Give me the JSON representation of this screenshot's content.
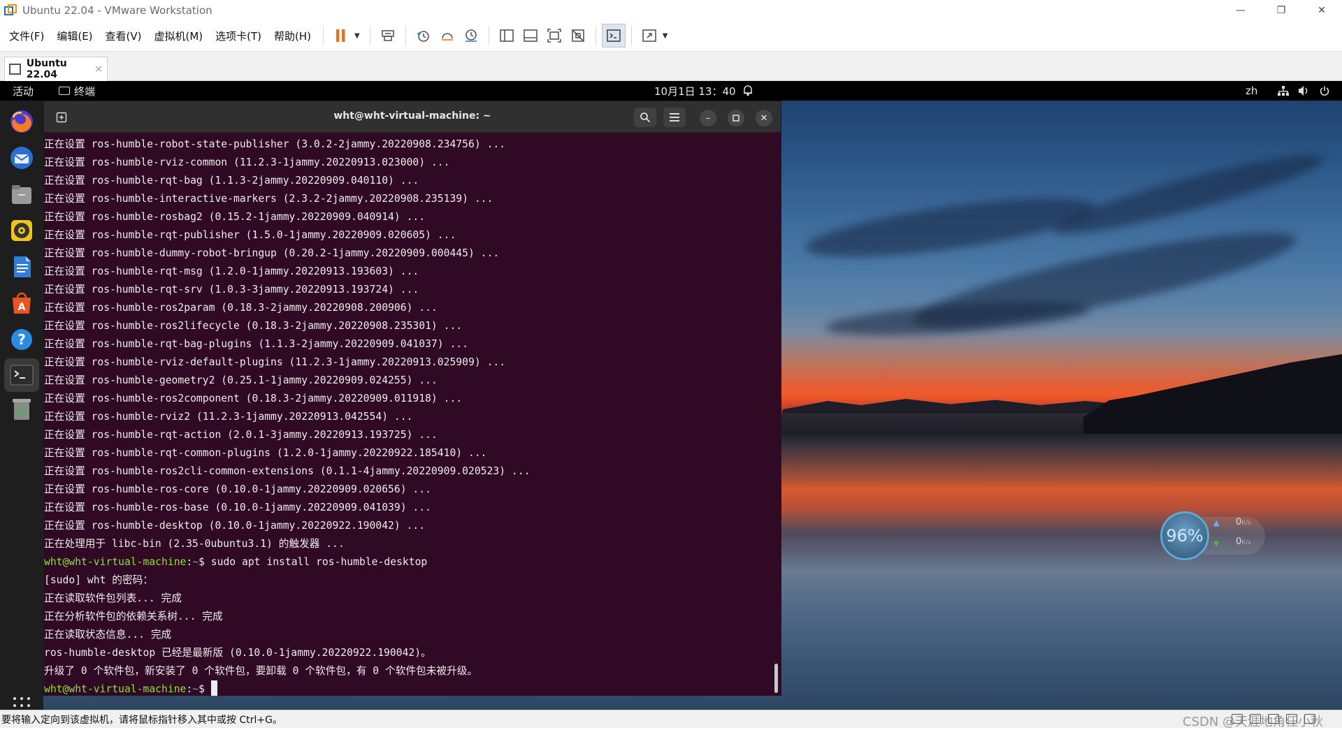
{
  "window": {
    "title": "Ubuntu 22.04 - VMware Workstation",
    "controls": {
      "minimize": "—",
      "restore": "❐",
      "close": "✕"
    }
  },
  "menu": [
    "文件(F)",
    "编辑(E)",
    "查看(V)",
    "虚拟机(M)",
    "选项卡(T)",
    "帮助(H)"
  ],
  "tab": {
    "label": "Ubuntu 22.04",
    "close": "×"
  },
  "gnome": {
    "activities": "活动",
    "app": "终端",
    "clock": "10月1日  13：40",
    "lang": "zh"
  },
  "terminal": {
    "title": "wht@wht-virtual-machine: ~",
    "lines": [
      "正在设置 ros-humble-robot-state-publisher (3.0.2-2jammy.20220908.234756) ...",
      "正在设置 ros-humble-rviz-common (11.2.3-1jammy.20220913.023000) ...",
      "正在设置 ros-humble-rqt-bag (1.1.3-2jammy.20220909.040110) ...",
      "正在设置 ros-humble-interactive-markers (2.3.2-2jammy.20220908.235139) ...",
      "正在设置 ros-humble-rosbag2 (0.15.2-1jammy.20220909.040914) ...",
      "正在设置 ros-humble-rqt-publisher (1.5.0-1jammy.20220909.020605) ...",
      "正在设置 ros-humble-dummy-robot-bringup (0.20.2-1jammy.20220909.000445) ...",
      "正在设置 ros-humble-rqt-msg (1.2.0-1jammy.20220913.193603) ...",
      "正在设置 ros-humble-rqt-srv (1.0.3-3jammy.20220913.193724) ...",
      "正在设置 ros-humble-ros2param (0.18.3-2jammy.20220908.200906) ...",
      "正在设置 ros-humble-ros2lifecycle (0.18.3-2jammy.20220908.235301) ...",
      "正在设置 ros-humble-rqt-bag-plugins (1.1.3-2jammy.20220909.041037) ...",
      "正在设置 ros-humble-rviz-default-plugins (11.2.3-1jammy.20220913.025909) ...",
      "正在设置 ros-humble-geometry2 (0.25.1-1jammy.20220909.024255) ...",
      "正在设置 ros-humble-ros2component (0.18.3-2jammy.20220909.011918) ...",
      "正在设置 ros-humble-rviz2 (11.2.3-1jammy.20220913.042554) ...",
      "正在设置 ros-humble-rqt-action (2.0.1-3jammy.20220913.193725) ...",
      "正在设置 ros-humble-rqt-common-plugins (1.2.0-1jammy.20220922.185410) ...",
      "正在设置 ros-humble-ros2cli-common-extensions (0.1.1-4jammy.20220909.020523) ...",
      "正在设置 ros-humble-ros-core (0.10.0-1jammy.20220909.020656) ...",
      "正在设置 ros-humble-ros-base (0.10.0-1jammy.20220909.041039) ...",
      "正在设置 ros-humble-desktop (0.10.0-1jammy.20220922.190042) ...",
      "正在处理用于 libc-bin (2.35-0ubuntu3.1) 的触发器 ..."
    ],
    "prompt_user": "wht@wht-virtual-machine",
    "prompt_sep": ":",
    "prompt_path": "~",
    "prompt_dollar": "$ ",
    "command": "sudo apt install ros-humble-desktop",
    "output": [
      "[sudo] wht 的密码：",
      "正在读取软件包列表... 完成",
      "正在分析软件包的依赖关系树... 完成",
      "正在读取状态信息... 完成",
      "ros-humble-desktop 已经是最新版 (0.10.0-1jammy.20220922.190042)。",
      "升级了 0 个软件包，新安装了 0 个软件包，要卸载 0 个软件包，有 0 个软件包未被升级。"
    ]
  },
  "net_widget": {
    "percent": "96%",
    "up": "0",
    "down": "0",
    "unit": "K/s"
  },
  "status": {
    "hint": "要将输入定向到该虚拟机，请将鼠标指针移入其中或按 Ctrl+G。",
    "watermark": "CSDN @天涯地角任小秋"
  },
  "colors": {
    "terminal_bg": "#300a24",
    "prompt_user": "#8ae234",
    "prompt_path": "#729fcf"
  }
}
